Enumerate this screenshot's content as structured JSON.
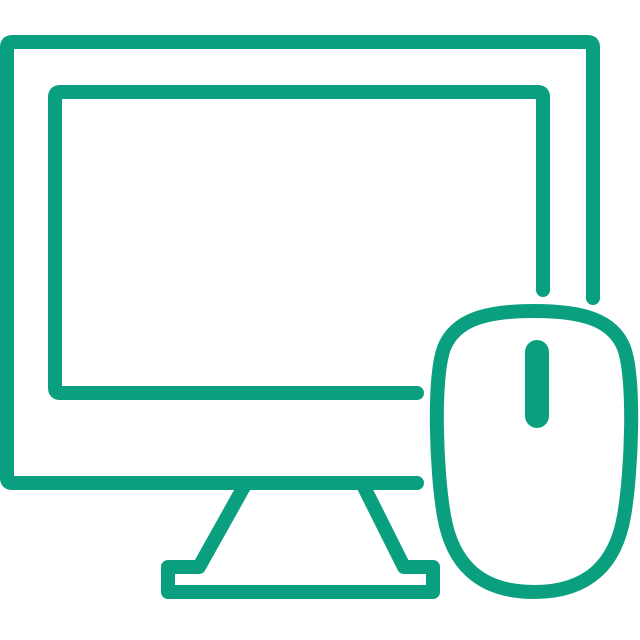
{
  "icon": {
    "name": "computer-and-mouse-icon",
    "color": "#0aa07f",
    "background": "#ffffff"
  }
}
